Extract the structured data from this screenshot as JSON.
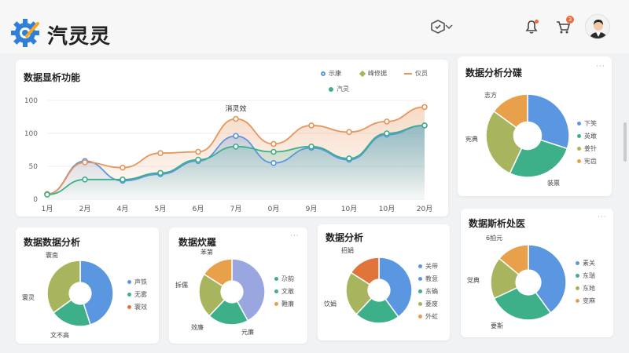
{
  "app": {
    "brand": "汽灵灵"
  },
  "header": {
    "icons": [
      "gear-logo-icon",
      "package-icon",
      "bell-icon",
      "cart-icon",
      "user-avatar"
    ],
    "cart_badge": "3",
    "accent": "#2f7fd9"
  },
  "main_chart": {
    "title": "数据显析功能",
    "more": "···",
    "legend": [
      "示康",
      "峰修据",
      "仪员",
      "汽灵"
    ]
  },
  "chart_data": [
    {
      "type": "line",
      "title": "数据显析功能",
      "categories": [
        "1月",
        "2月",
        "4月",
        "5月",
        "6月",
        "7月",
        "0月",
        "9月",
        "10月",
        "10月",
        "20月"
      ],
      "yticks": [
        "0",
        "50",
        "100",
        "100"
      ],
      "ylim": [
        0,
        150
      ],
      "annotation": {
        "text": "消灵效",
        "at": "7月"
      },
      "series": [
        {
          "name": "示康",
          "color": "#5b96e0",
          "values": [
            8,
            58,
            28,
            38,
            58,
            96,
            55,
            78,
            60,
            98,
            112
          ]
        },
        {
          "name": "仪员",
          "color": "#e8945a",
          "values": [
            8,
            56,
            48,
            70,
            72,
            122,
            84,
            112,
            102,
            118,
            140
          ]
        },
        {
          "name": "汽灵",
          "color": "#3db08a",
          "values": [
            7,
            30,
            30,
            40,
            60,
            80,
            72,
            80,
            62,
            100,
            112
          ]
        }
      ],
      "legend_position": "top-right"
    },
    {
      "type": "pie",
      "title": "数据分析分碟",
      "labels": [
        "下笑",
        "英敢",
        "姜针",
        "宪齿"
      ],
      "values": [
        30,
        27,
        28,
        15
      ],
      "colors": [
        "#5b96e0",
        "#3db08a",
        "#a9b45e",
        "#e8a04a"
      ],
      "slice_labels": [
        "志方",
        "宪典",
        "装票"
      ],
      "legend_position": "right"
    },
    {
      "type": "pie",
      "title": "数据数据分析",
      "labels": [
        "声铁",
        "无雾",
        "寰效"
      ],
      "values": [
        45,
        20,
        35
      ],
      "colors": [
        "#5b96e0",
        "#3db08a",
        "#e0743a"
      ],
      "slice_colors": [
        "#5b96e0",
        "#3db08a",
        "#a9b45e",
        "#e8a04a"
      ],
      "slice_labels": [
        "寰南",
        "寰灵",
        "文不高"
      ],
      "legend_position": "right"
    },
    {
      "type": "pie",
      "title": "数据炊羅",
      "labels": [
        "尕韵",
        "文敢",
        "難廉"
      ],
      "values": [
        42,
        20,
        22,
        16
      ],
      "colors": [
        "#3db08a",
        "#3db08a",
        "#e8a04a"
      ],
      "slice_colors": [
        "#9aa6e0",
        "#3db08a",
        "#a9b45e",
        "#e8a04a"
      ],
      "slice_labels": [
        "苯第",
        "拆儒",
        "效廉",
        "元廉"
      ],
      "legend_position": "right"
    },
    {
      "type": "pie",
      "title": "数据分析",
      "labels": [
        "关带",
        "教意",
        "东确",
        "菱废",
        "外虹"
      ],
      "values": [
        40,
        22,
        22,
        16
      ],
      "colors": [
        "#5b96e0",
        "#5b96e0",
        "#3db08a",
        "#a9b45e",
        "#e8a04a"
      ],
      "slice_colors": [
        "#5b96e0",
        "#3db08a",
        "#a9b45e",
        "#e0743a"
      ],
      "slice_labels": [
        "招娟",
        "饮娟"
      ],
      "legend_position": "right"
    },
    {
      "type": "pie",
      "title": "数据斯析处医",
      "labels": [
        "素关",
        "东瑞",
        "东她",
        "变麻"
      ],
      "values": [
        40,
        28,
        18,
        14
      ],
      "colors": [
        "#5b96e0",
        "#3db08a",
        "#a9b45e",
        "#e8a04a"
      ],
      "slice_labels": [
        "6拍元",
        "党典",
        "要斯"
      ],
      "legend_position": "right"
    }
  ]
}
